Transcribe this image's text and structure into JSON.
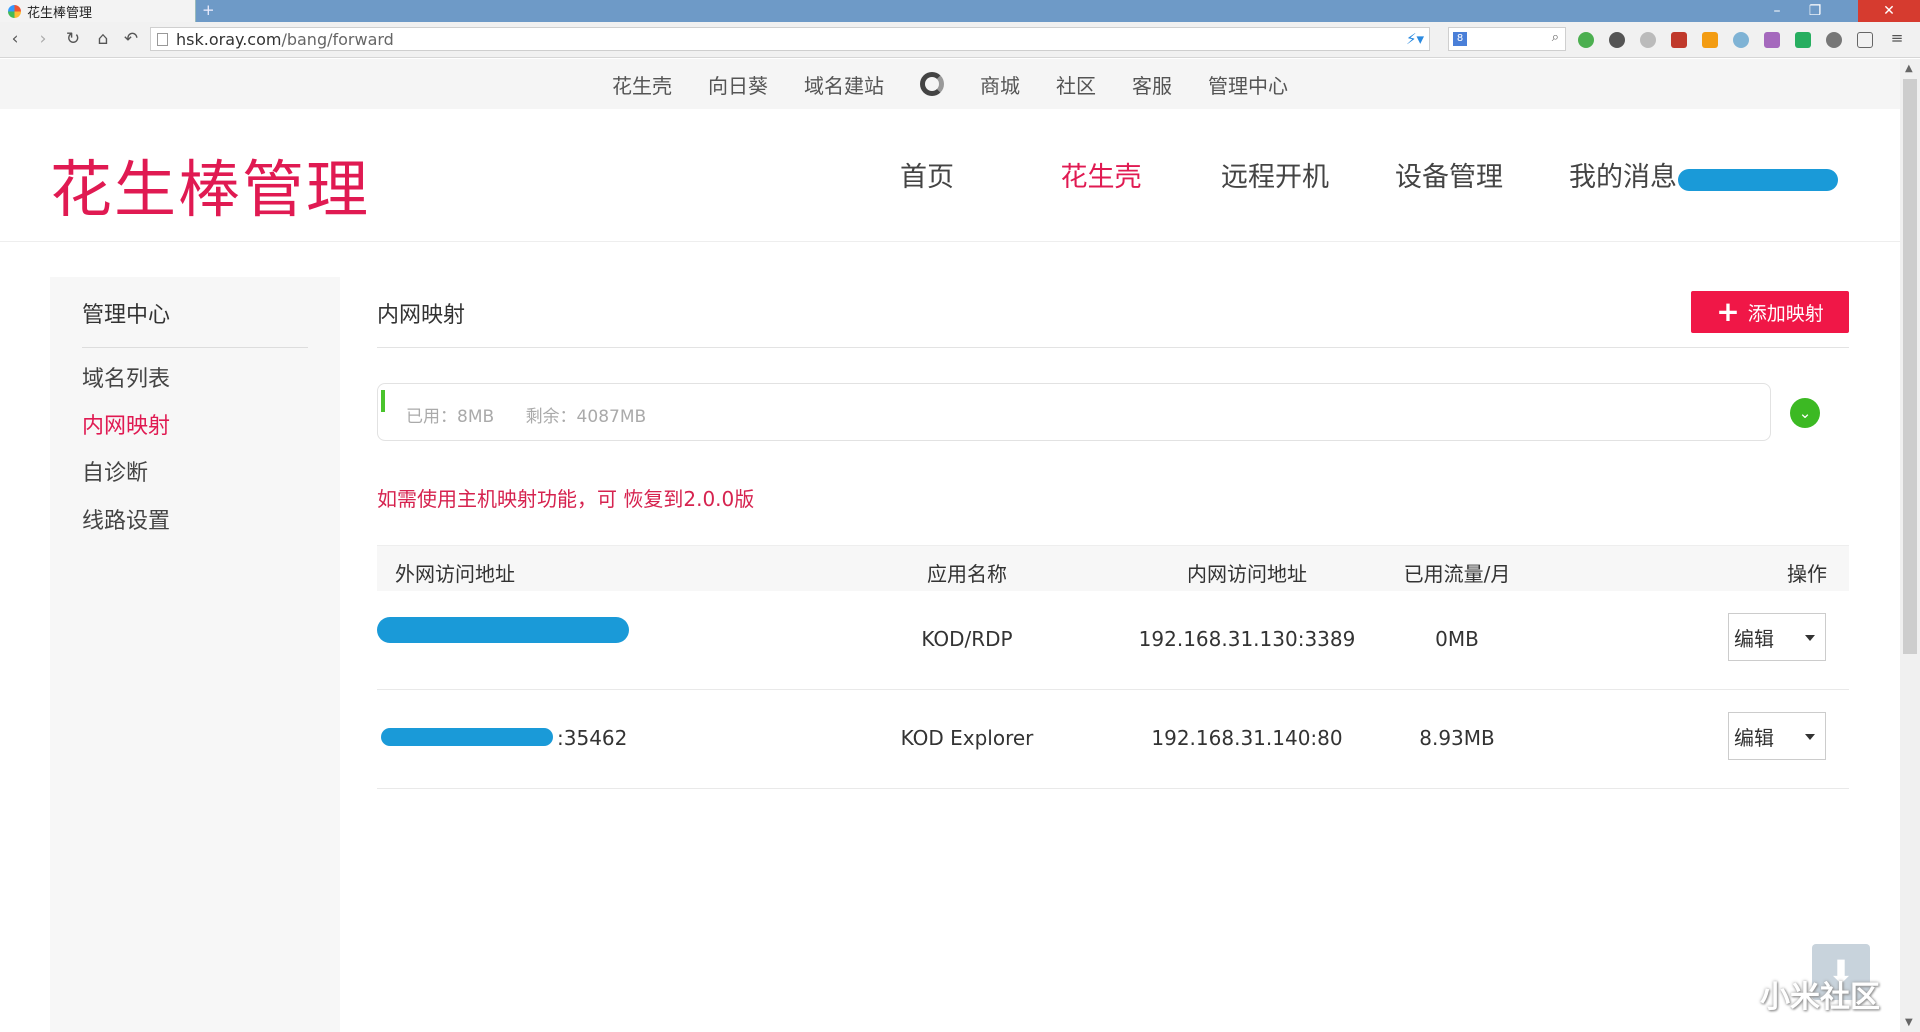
{
  "browser": {
    "tab_title": "花生棒管理",
    "new_tab": "+",
    "url_host": "hsk.oray.com",
    "url_path": "/bang/forward",
    "minimize": "–",
    "maximize": "❐",
    "close": "✕"
  },
  "toplinks": [
    "花生壳",
    "向日葵",
    "域名建站",
    "商城",
    "社区",
    "客服",
    "管理中心"
  ],
  "brand": "花生棒管理",
  "mainnav": [
    {
      "label": "首页",
      "active": false
    },
    {
      "label": "花生壳",
      "active": true
    },
    {
      "label": "远程开机",
      "active": false
    },
    {
      "label": "设备管理",
      "active": false
    },
    {
      "label": "我的消息",
      "active": false
    }
  ],
  "sidebar": {
    "title": "管理中心",
    "items": [
      {
        "label": "域名列表",
        "active": false
      },
      {
        "label": "内网映射",
        "active": true
      },
      {
        "label": "自诊断",
        "active": false
      },
      {
        "label": "线路设置",
        "active": false
      }
    ]
  },
  "content": {
    "title": "内网映射",
    "add_button": "添加映射",
    "usage_used": "已用：8MB",
    "usage_remaining": "剩余：4087MB",
    "notice": "如需使用主机映射功能，可 恢复到2.0.0版",
    "table": {
      "headers": [
        "外网访问地址",
        "应用名称",
        "内网访问地址",
        "已用流量/月",
        "操作"
      ],
      "rows": [
        {
          "external": "",
          "app": "KOD/RDP",
          "internal": "192.168.31.130:3389",
          "traffic": "0MB",
          "action": "编辑"
        },
        {
          "external": ":35462",
          "app": "KOD Explorer",
          "internal": "192.168.31.140:80",
          "traffic": "8.93MB",
          "action": "编辑"
        }
      ]
    }
  },
  "watermark": "小米社区",
  "colors": {
    "accent": "#e01a52",
    "button": "#f01747",
    "ok": "#3cb923",
    "redaction": "#1a9ad8"
  }
}
